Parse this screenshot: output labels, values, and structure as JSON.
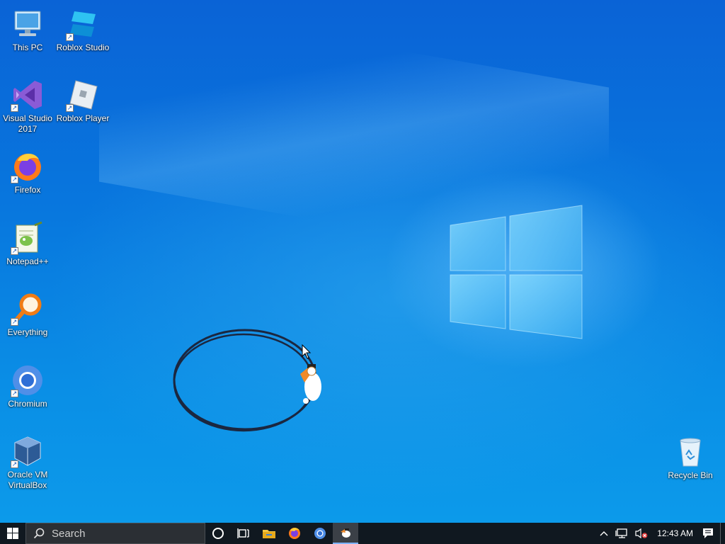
{
  "desktop": {
    "icons": [
      {
        "label": "This PC",
        "icon": "this-pc-icon"
      },
      {
        "label": "Roblox Studio",
        "icon": "roblox-studio-icon"
      },
      {
        "label": "Visual Studio 2017",
        "icon": "visual-studio-icon"
      },
      {
        "label": "Roblox Player",
        "icon": "roblox-player-icon"
      },
      {
        "label": "Firefox",
        "icon": "firefox-icon"
      },
      {
        "label": "Notepad++",
        "icon": "notepad-plus-plus-icon"
      },
      {
        "label": "Everything",
        "icon": "everything-search-icon"
      },
      {
        "label": "Chromium",
        "icon": "chromium-icon"
      },
      {
        "label": "Oracle VM VirtualBox",
        "icon": "virtualbox-icon"
      },
      {
        "label": "Recycle Bin",
        "icon": "recycle-bin-icon"
      }
    ],
    "wallpaper": {
      "primary_color": "#0a63d6",
      "accent_color": "#7cd0ff"
    }
  },
  "taskbar": {
    "search_placeholder": "Search",
    "pinned": [
      {
        "name": "cortana",
        "icon": "cortana-circle-icon"
      },
      {
        "name": "task-view",
        "icon": "task-view-icon"
      },
      {
        "name": "file-explorer",
        "icon": "folder-icon"
      },
      {
        "name": "firefox",
        "icon": "firefox-icon"
      },
      {
        "name": "chromium",
        "icon": "chromium-icon"
      },
      {
        "name": "running-app",
        "icon": "cat-sprite-icon",
        "active": true
      }
    ],
    "tray": {
      "time": "12:43 AM",
      "icons": [
        "chevron-up-icon",
        "network-icon",
        "volume-muted-icon",
        "notifications-icon"
      ]
    }
  }
}
